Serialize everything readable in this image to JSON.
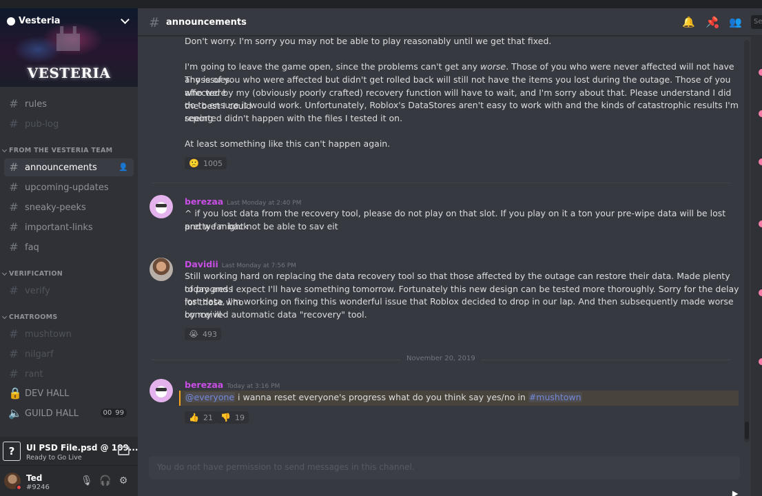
{
  "server": {
    "name": "Vesteria",
    "banner_logo": "VESTERIA"
  },
  "sidebar": {
    "top_channels": [
      {
        "name": "rules",
        "muted": false
      },
      {
        "name": "pub-log",
        "muted": true
      }
    ],
    "categories": [
      {
        "label": "FROM THE VESTERIA TEAM",
        "channels": [
          "announcements",
          "upcoming-updates",
          "sneaky-peeks",
          "important-links",
          "faq"
        ]
      },
      {
        "label": "VERIFICATION",
        "channels": [
          "verify"
        ]
      },
      {
        "label": "CHATROOMS",
        "channels": [
          "mushtown",
          "nilgarf",
          "rant"
        ]
      }
    ],
    "voice": [
      {
        "name": "DEV HALL",
        "icon": "lock-icon"
      },
      {
        "name": "GUILD HALL",
        "icon": "speaker-icon",
        "counts": [
          "00",
          "99"
        ]
      }
    ]
  },
  "golive": {
    "title": "UI PSD File.psd @ 109...",
    "subtitle": "Ready to Go Live"
  },
  "user": {
    "name": "Ted",
    "tag": "#9246"
  },
  "header": {
    "channel": "announcements",
    "search_stub": "Se"
  },
  "messages": {
    "m0": {
      "lines": [
        "Don't worry. I'm sorry you may not be able to play reasonably until we get that fixed.",
        "I'm going to leave the game open, since the problems can't get any",
        "worse",
        ". Those of you who were never affected will not have any issues.",
        "Those of you who were affected but didn't get rolled back will still not have the items you lost during the outage. Those of you who were",
        "affected by my (obviously poorly crafted) recovery function will have to wait, and I'm sorry about that. Please understand I did the best I could",
        "do to ensure it would work. Unfortunately, Roblox's DataStores aren't easy to work with and the kinds of catastrophic results I'm seeing",
        "reported didn't happen with the files I tested it on.",
        "At least something like this can't happen again."
      ],
      "reaction": {
        "emoji": "🙁",
        "count": "1005"
      }
    },
    "m1": {
      "author": "berezaa",
      "author_color": "#c84ee6",
      "timestamp": "Last Monday at 2:40 PM",
      "lines": [
        "^ if you lost data from the recovery tool, please do not play on that slot. If you play on it a ton your pre-wipe data will be lost pretty far back",
        "and we might not be able to sav eit"
      ]
    },
    "m2": {
      "author": "Davidii",
      "author_color": "#c84ee6",
      "timestamp": "Last Monday at 7:56 PM",
      "lines": [
        "Still working hard on replacing the data recovery tool so that those affected by the outage can restore their data. Made plenty of progress",
        "today and I expect I'll have something tomorrow. Fortunately this new design can be tested more thoroughly. Sorry for the delay for those who",
        "lost data, I'm working on fixing this wonderful issue that Roblox decided to drop in our lap. And then subsequently made worse by my ill-",
        "conceived automatic data \"recovery\" tool."
      ],
      "reaction": {
        "emoji": "😭",
        "count": "493"
      }
    },
    "date_divider": "November 20, 2019",
    "m3": {
      "author": "berezaa",
      "author_color": "#c84ee6",
      "timestamp": "Today at 3:16 PM",
      "mention": "@everyone",
      "text": " i wanna reset everyone's progress what do you think say yes/no in ",
      "channel_link": "#mushtown",
      "reactions": [
        {
          "emoji": "👍",
          "count": "21"
        },
        {
          "emoji": "👎",
          "count": "19"
        }
      ]
    }
  },
  "input": {
    "placeholder": "You do not have permission to send messages in this channel."
  }
}
